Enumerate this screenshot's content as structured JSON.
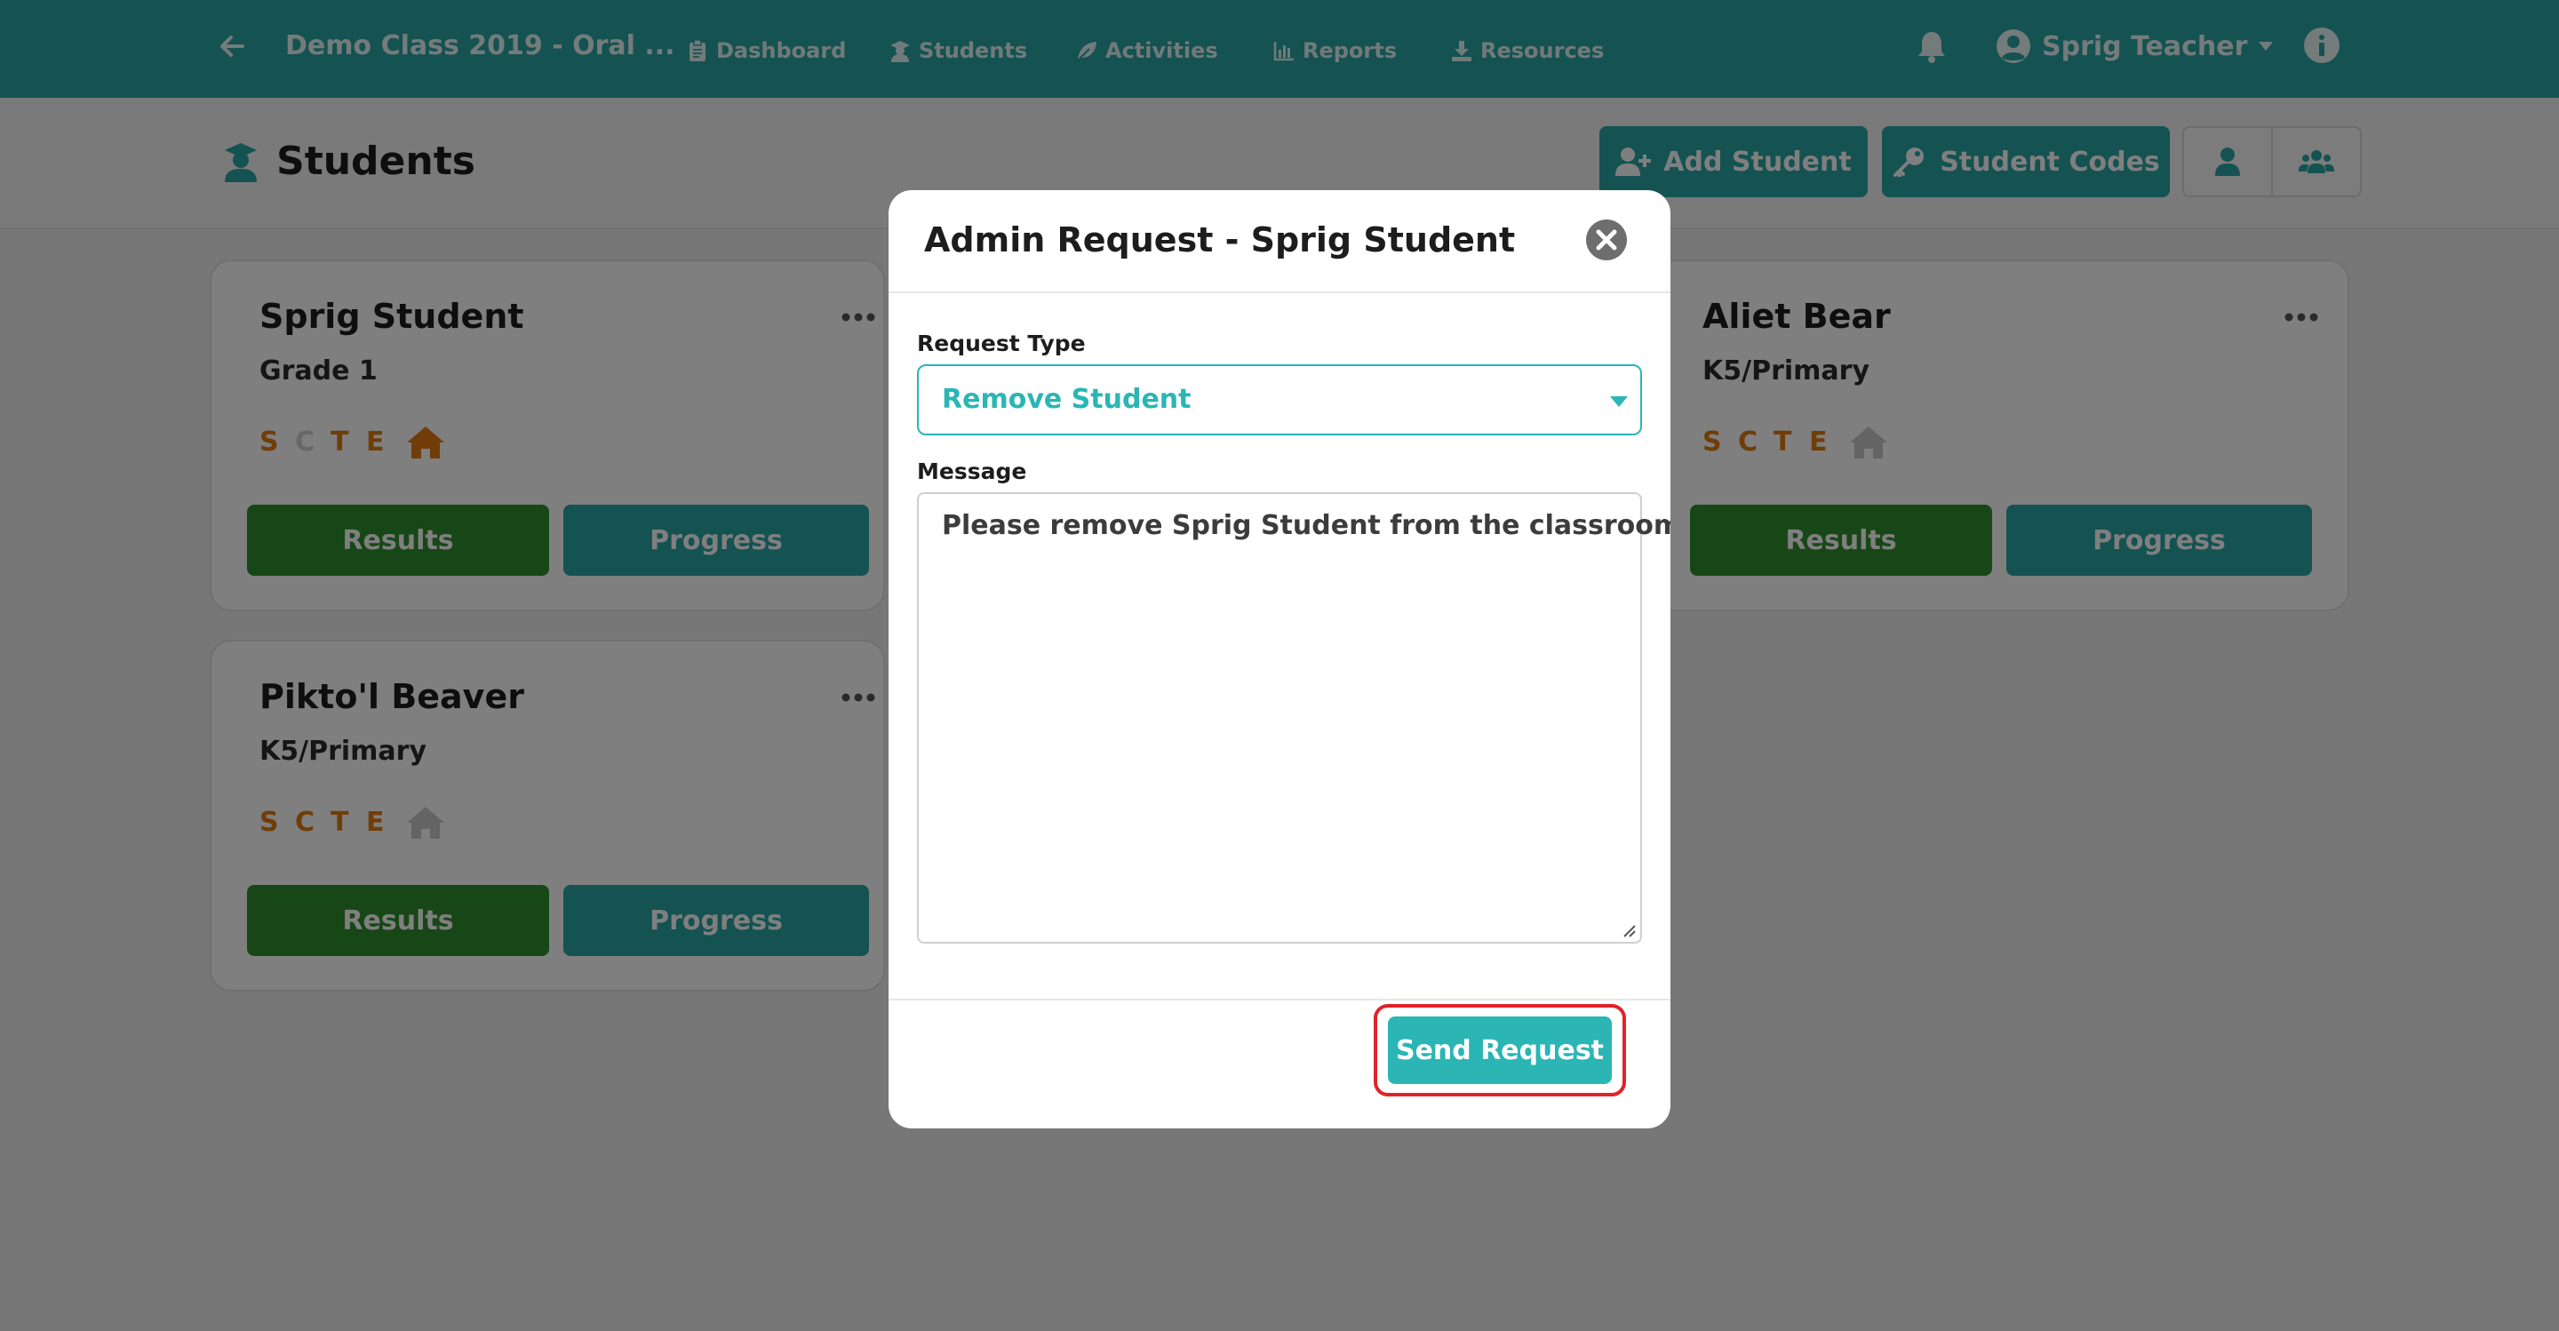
{
  "navbar": {
    "class_title": "Demo Class 2019 - Oral ...",
    "links": [
      {
        "label": "Dashboard",
        "icon": "clipboard-icon"
      },
      {
        "label": "Students",
        "icon": "student-icon"
      },
      {
        "label": "Activities",
        "icon": "leaf-icon"
      },
      {
        "label": "Reports",
        "icon": "bar-chart-icon"
      },
      {
        "label": "Resources",
        "icon": "download-icon"
      }
    ],
    "user_name": "Sprig Teacher"
  },
  "page": {
    "title": "Students",
    "add_student_label": "Add Student",
    "student_codes_label": "Student Codes"
  },
  "students": [
    {
      "name": "Sprig Student",
      "grade": "Grade 1",
      "results_label": "Results",
      "progress_label": "Progress"
    },
    {
      "name": "Aliet Bear",
      "grade": "K5/Primary",
      "results_label": "Results",
      "progress_label": "Progress"
    },
    {
      "name": "Pikto'l Beaver",
      "grade": "K5/Primary",
      "results_label": "Results",
      "progress_label": "Progress"
    }
  ],
  "scte_letters": [
    "S",
    "C",
    "T",
    "E"
  ],
  "modal": {
    "title": "Admin Request - Sprig Student",
    "request_type_label": "Request Type",
    "request_type_value": "Remove Student",
    "message_label": "Message",
    "message_value": "Please remove Sprig Student from the classroom.",
    "send_label": "Send Request"
  },
  "colors": {
    "teal": "#2aa5a5",
    "green": "#2f8e2c",
    "orange": "#e07b12",
    "highlight_red": "#e0242a"
  }
}
